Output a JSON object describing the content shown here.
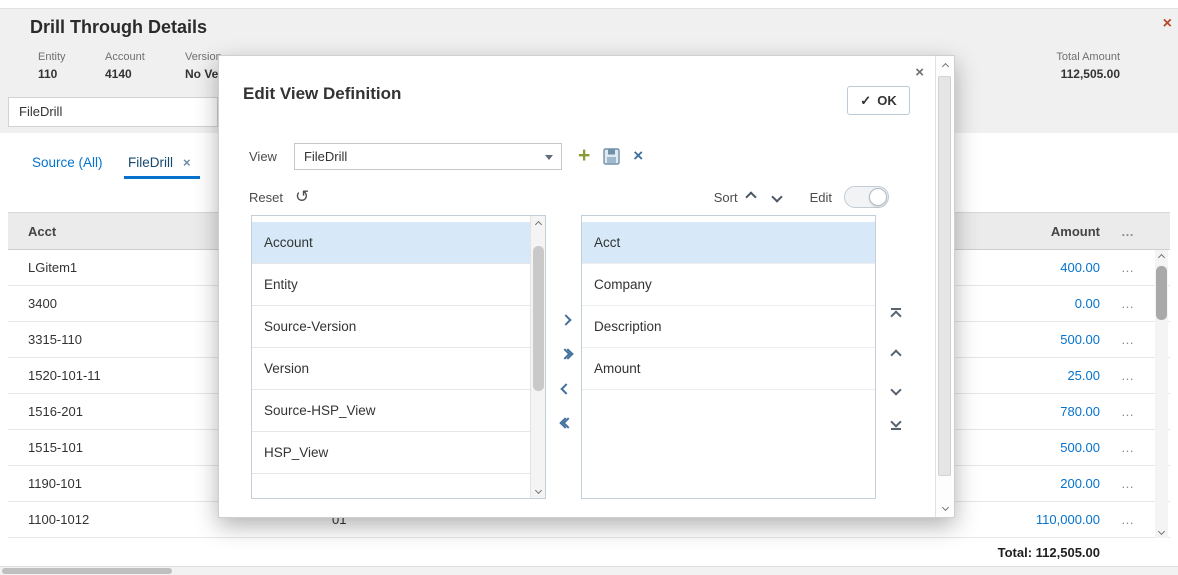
{
  "page": {
    "title": "Drill Through Details",
    "pov": {
      "items": [
        {
          "label": "Entity",
          "value": "110"
        },
        {
          "label": "Account",
          "value": "4140"
        },
        {
          "label": "Version",
          "value": "No Ve"
        }
      ],
      "total": {
        "label": "Total Amount",
        "value": "112,505.00"
      }
    },
    "filter_field": {
      "value": "FileDrill"
    },
    "tabs": {
      "source": "Source (All)",
      "filedrill": "FileDrill"
    },
    "table": {
      "header": {
        "acct": "Acct",
        "amount": "Amount"
      },
      "rows": [
        {
          "acct": "LGitem1",
          "amount": "400.00"
        },
        {
          "acct": "3400",
          "amount": "0.00"
        },
        {
          "acct": "3315-110",
          "amount": "500.00"
        },
        {
          "acct": "1520-101-11",
          "amount": "25.00"
        },
        {
          "acct": "1516-201",
          "amount": "780.00"
        },
        {
          "acct": "1515-101",
          "amount": "500.00"
        },
        {
          "acct": "1190-101",
          "amount": "200.00"
        },
        {
          "acct": "1100-1012",
          "period": "01",
          "amount": "110,000.00"
        }
      ],
      "total": "Total: 112,505.00"
    }
  },
  "modal": {
    "title": "Edit View Definition",
    "ok": "OK",
    "view": {
      "label": "View",
      "value": "FileDrill"
    },
    "reset_label": "Reset",
    "sort_label": "Sort",
    "edit_label": "Edit",
    "available_items": [
      "Account",
      "Entity",
      "Source-Version",
      "Version",
      "Source-HSP_View",
      "HSP_View"
    ],
    "selected_items": [
      "Acct",
      "Company",
      "Description",
      "Amount"
    ]
  },
  "icons": {
    "close": "×",
    "check": "✓",
    "add": "+",
    "delete": "×",
    "reset": "↺",
    "overflow": "…"
  },
  "colors": {
    "accent_blue": "#0572ce",
    "selection_blue": "#d7e9f8"
  }
}
